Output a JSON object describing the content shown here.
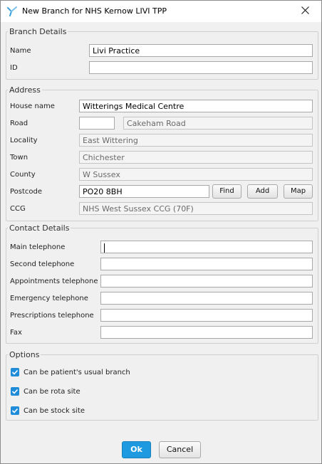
{
  "window": {
    "title": "New Branch for NHS Kernow LIVI TPP",
    "icon": "tpp-app-icon",
    "accent_color": "#1e8cd8"
  },
  "branch_details": {
    "legend": "Branch Details",
    "name_label": "Name",
    "name_value": "Livi Practice",
    "id_label": "ID",
    "id_value": ""
  },
  "address": {
    "legend": "Address",
    "house_name_label": "House name",
    "house_name_value": "Witterings Medical Centre",
    "road_label": "Road",
    "road_number_value": "",
    "road_value": "Cakeham Road",
    "locality_label": "Locality",
    "locality_value": "East Wittering",
    "town_label": "Town",
    "town_value": "Chichester",
    "county_label": "County",
    "county_value": "W Sussex",
    "postcode_label": "Postcode",
    "postcode_value": "PO20 8BH",
    "find_button": "Find",
    "add_button": "Add",
    "map_button": "Map",
    "ccg_label": "CCG",
    "ccg_value": "NHS West Sussex CCG (70F)"
  },
  "contact_details": {
    "legend": "Contact Details",
    "fields": [
      {
        "label": "Main telephone",
        "value": ""
      },
      {
        "label": "Second telephone",
        "value": ""
      },
      {
        "label": "Appointments telephone",
        "value": ""
      },
      {
        "label": "Emergency telephone",
        "value": ""
      },
      {
        "label": "Prescriptions telephone",
        "value": ""
      },
      {
        "label": "Fax",
        "value": ""
      }
    ]
  },
  "options": {
    "legend": "Options",
    "checkboxes": [
      {
        "label": "Can be patient's usual branch",
        "checked": true
      },
      {
        "label": "Can be rota site",
        "checked": true
      },
      {
        "label": "Can be stock site",
        "checked": true
      }
    ]
  },
  "footer": {
    "ok_label": "Ok",
    "cancel_label": "Cancel"
  }
}
